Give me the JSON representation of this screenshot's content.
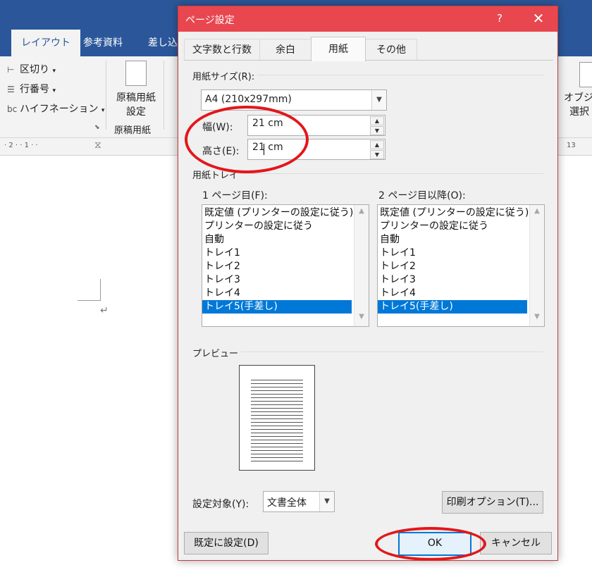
{
  "word": {
    "tabs": [
      "レイアウト",
      "参考資料",
      "差し込"
    ],
    "ribbon": {
      "section_break": "区切り",
      "line_numbers": "行番号",
      "hyphenation": "ハイフネーション",
      "manuscript_line1": "原稿用紙",
      "manuscript_line2": "設定",
      "manuscript_group": "原稿用紙",
      "object_line1": "オブジ",
      "object_line2": "選択"
    },
    "ruler_left": "· 2 · · 1 · ·",
    "ruler_right": "13"
  },
  "dialog": {
    "title": "ページ設定",
    "help": "?",
    "close": "✕",
    "tabs": [
      "文字数と行数",
      "余白",
      "用紙",
      "その他"
    ],
    "paper_size": {
      "label": "用紙サイズ(R):",
      "value": "A4 (210x297mm)",
      "width_label": "幅(W):",
      "width_value": "21 cm",
      "height_label": "高さ(E):",
      "height_value": "21 cm"
    },
    "paper_tray": {
      "label": "用紙トレイ",
      "first_label": "1 ページ目(F):",
      "other_label": "2 ページ目以降(O):",
      "items": [
        "既定値 (プリンターの設定に従う)",
        "プリンターの設定に従う",
        "自動",
        "トレイ1",
        "トレイ2",
        "トレイ3",
        "トレイ4",
        "トレイ5(手差し)"
      ],
      "selected": "トレイ5(手差し)"
    },
    "preview": {
      "label": "プレビュー"
    },
    "apply_to": {
      "label": "設定対象(Y):",
      "value": "文書全体"
    },
    "print_options": "印刷オプション(T)...",
    "set_default": "既定に設定(D)",
    "ok": "OK",
    "cancel": "キャンセル"
  },
  "colors": {
    "titlebar": "#e8474f",
    "ribbon": "#2b579a",
    "selection": "#0078d7",
    "annotation": "#e3161b"
  }
}
